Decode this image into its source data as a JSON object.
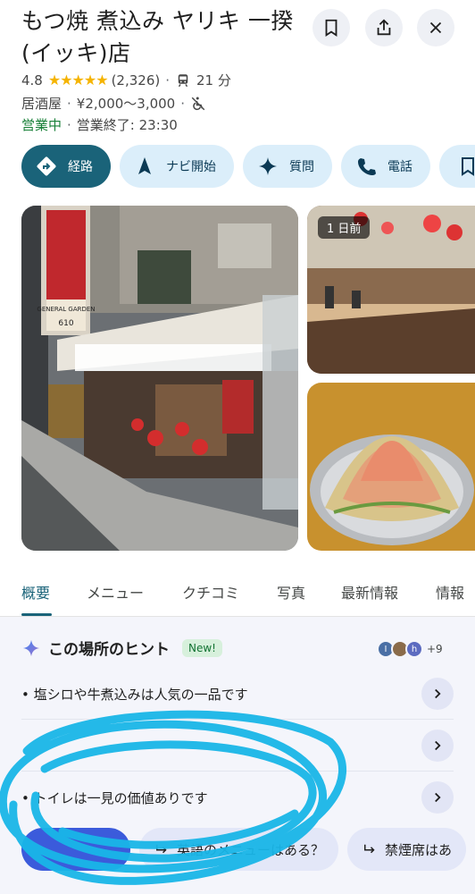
{
  "place": {
    "name": "もつ焼 煮込み ヤリキ 一揆(イッキ)店",
    "rating": "4.8",
    "stars": "★★★★★",
    "review_count": "(2,326)",
    "transit_time": "21 分",
    "category": "居酒屋",
    "price": "¥2,000～3,000",
    "open_status": "営業中",
    "close_info": "営業終了: 23:30"
  },
  "actions": [
    {
      "label": "経路",
      "icon": "directions-icon"
    },
    {
      "label": "ナビ開始",
      "icon": "navigation-icon"
    },
    {
      "label": "質問",
      "icon": "sparkle-icon"
    },
    {
      "label": "電話",
      "icon": "phone-icon"
    },
    {
      "label": "",
      "icon": "bookmark-icon"
    }
  ],
  "photos": {
    "badge": "1 日前",
    "storefront_sign": "GENERAL GARDEN",
    "storefront_number": "610"
  },
  "tabs": [
    "概要",
    "メニュー",
    "クチコミ",
    "写真",
    "最新情報",
    "情報"
  ],
  "hints": {
    "title": "この場所のヒント",
    "new_badge": "New!",
    "avatar_letters": [
      "I",
      "",
      "h"
    ],
    "more": "+9",
    "items": [
      "塩シロや牛煮込みは人気の一品です",
      "",
      "トイレは一見の価値ありです"
    ]
  },
  "questions": [
    "",
    "英語のメニューはある？",
    "禁煙席はあ"
  ],
  "colors": {
    "accent": "#1a6379",
    "chip_bg": "#dbeefa",
    "star": "#f5b400",
    "open": "#188038",
    "scribble": "#19b6e8"
  }
}
